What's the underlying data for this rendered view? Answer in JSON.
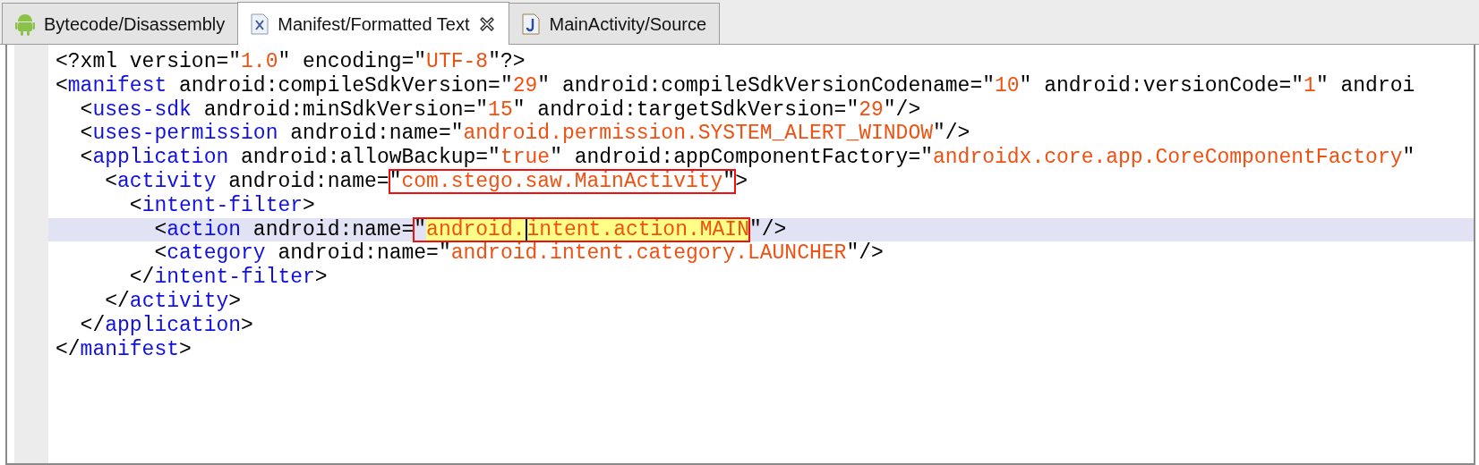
{
  "tabs": [
    {
      "label": "Bytecode/Disassembly",
      "kind": "android",
      "selected": false,
      "closable": false
    },
    {
      "label": "Manifest/Formatted Text",
      "kind": "xml",
      "selected": true,
      "closable": true
    },
    {
      "label": "MainActivity/Source",
      "kind": "java",
      "selected": false,
      "closable": false
    }
  ],
  "lines": [
    {
      "current": false,
      "tokens": [
        {
          "kind": "punct",
          "text": "<?xml version=\""
        },
        {
          "kind": "value",
          "text": "1.0"
        },
        {
          "kind": "punct",
          "text": "\" encoding=\""
        },
        {
          "kind": "value",
          "text": "UTF-8"
        },
        {
          "kind": "punct",
          "text": "\"?>"
        }
      ]
    },
    {
      "current": false,
      "tokens": [
        {
          "kind": "punct",
          "text": "<"
        },
        {
          "kind": "tag",
          "text": "manifest"
        },
        {
          "kind": "punct",
          "text": " android:compileSdkVersion=\""
        },
        {
          "kind": "value",
          "text": "29"
        },
        {
          "kind": "punct",
          "text": "\" android:compileSdkVersionCodename=\""
        },
        {
          "kind": "value",
          "text": "10"
        },
        {
          "kind": "punct",
          "text": "\" android:versionCode=\""
        },
        {
          "kind": "value",
          "text": "1"
        },
        {
          "kind": "punct",
          "text": "\" androi"
        }
      ]
    },
    {
      "current": false,
      "tokens": [
        {
          "kind": "punct",
          "text": "  <"
        },
        {
          "kind": "tag",
          "text": "uses-sdk"
        },
        {
          "kind": "punct",
          "text": " android:minSdkVersion=\""
        },
        {
          "kind": "value",
          "text": "15"
        },
        {
          "kind": "punct",
          "text": "\" android:targetSdkVersion=\""
        },
        {
          "kind": "value",
          "text": "29"
        },
        {
          "kind": "punct",
          "text": "\"/>"
        }
      ]
    },
    {
      "current": false,
      "tokens": [
        {
          "kind": "punct",
          "text": "  <"
        },
        {
          "kind": "tag",
          "text": "uses-permission"
        },
        {
          "kind": "punct",
          "text": " android:name=\""
        },
        {
          "kind": "value",
          "text": "android.permission.SYSTEM_ALERT_WINDOW"
        },
        {
          "kind": "punct",
          "text": "\"/>"
        }
      ]
    },
    {
      "current": false,
      "tokens": [
        {
          "kind": "punct",
          "text": "  <"
        },
        {
          "kind": "tag",
          "text": "application"
        },
        {
          "kind": "punct",
          "text": " android:allowBackup=\""
        },
        {
          "kind": "value",
          "text": "true"
        },
        {
          "kind": "punct",
          "text": "\" android:appComponentFactory=\""
        },
        {
          "kind": "value",
          "text": "androidx.core.app.CoreComponentFactory"
        },
        {
          "kind": "punct",
          "text": "\""
        }
      ]
    },
    {
      "current": false,
      "tokens": [
        {
          "kind": "punct",
          "text": "    <"
        },
        {
          "kind": "tag",
          "text": "activity"
        },
        {
          "kind": "punct",
          "text": " android:name="
        },
        {
          "kind": "annotation",
          "tokens": [
            {
              "kind": "punct",
              "text": "\""
            },
            {
              "kind": "value",
              "text": "com.stego.saw.MainActivity"
            },
            {
              "kind": "punct",
              "text": "\""
            }
          ]
        },
        {
          "kind": "punct",
          "text": ">"
        }
      ]
    },
    {
      "current": false,
      "tokens": [
        {
          "kind": "punct",
          "text": "      <"
        },
        {
          "kind": "tag",
          "text": "intent-filter"
        },
        {
          "kind": "punct",
          "text": ">"
        }
      ]
    },
    {
      "current": true,
      "tokens": [
        {
          "kind": "punct",
          "text": "        <"
        },
        {
          "kind": "tag",
          "text": "action"
        },
        {
          "kind": "punct",
          "text": " android:name="
        },
        {
          "kind": "annotation",
          "tokens": [
            {
              "kind": "punct",
              "text": "\""
            },
            {
              "kind": "match",
              "text": "android.",
              "caret_after": true
            },
            {
              "kind": "match",
              "text": "intent.action.MAIN",
              "caret_after": false
            }
          ]
        },
        {
          "kind": "punct",
          "text": "\"/>"
        }
      ]
    },
    {
      "current": false,
      "tokens": [
        {
          "kind": "punct",
          "text": "        <"
        },
        {
          "kind": "tag",
          "text": "category"
        },
        {
          "kind": "punct",
          "text": " android:name=\""
        },
        {
          "kind": "value",
          "text": "android.intent.category.LAUNCHER"
        },
        {
          "kind": "punct",
          "text": "\"/>"
        }
      ]
    },
    {
      "current": false,
      "tokens": [
        {
          "kind": "punct",
          "text": "      </"
        },
        {
          "kind": "tag",
          "text": "intent-filter"
        },
        {
          "kind": "punct",
          "text": ">"
        }
      ]
    },
    {
      "current": false,
      "tokens": [
        {
          "kind": "punct",
          "text": "    </"
        },
        {
          "kind": "tag",
          "text": "activity"
        },
        {
          "kind": "punct",
          "text": ">"
        }
      ]
    },
    {
      "current": false,
      "tokens": [
        {
          "kind": "punct",
          "text": "  </"
        },
        {
          "kind": "tag",
          "text": "application"
        },
        {
          "kind": "punct",
          "text": ">"
        }
      ]
    },
    {
      "current": false,
      "tokens": [
        {
          "kind": "punct",
          "text": "</"
        },
        {
          "kind": "tag",
          "text": "manifest"
        },
        {
          "kind": "punct",
          "text": ">"
        }
      ]
    }
  ]
}
